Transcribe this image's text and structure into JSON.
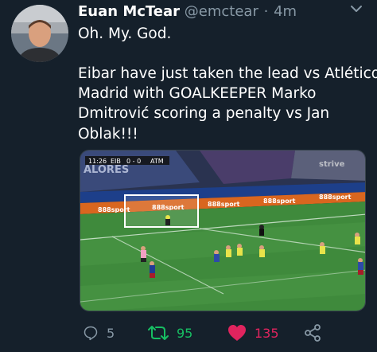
{
  "tweet": {
    "author_name": "Euan McTear",
    "author_handle": "@emctear",
    "separator": "·",
    "time": "4m",
    "text_lines": [
      "Oh. My. God.",
      "Eibar have just taken the lead vs Atlético",
      "Madrid with GOALKEEPER Marko",
      "Dmitrović scoring a penalty vs Jan",
      "Oblak!!!"
    ]
  },
  "media": {
    "scoreboard": {
      "clock": "11:26",
      "home": "EIB",
      "score": "0 - 0",
      "away": "ATM"
    },
    "stand_text": "ALORES",
    "ad_boards": [
      "888sport",
      "888sport",
      "888sport",
      "888sport",
      "888sport"
    ],
    "watermark": "strive"
  },
  "actions": {
    "replies": "5",
    "retweets": "95",
    "likes": "135"
  },
  "colors": {
    "background": "#15202b",
    "secondary_text": "#8899a6",
    "retweet_green": "#17bf63",
    "like_pink": "#e0245e"
  },
  "icons": {
    "menu": "chevron-down-icon",
    "reply": "reply-icon",
    "retweet": "retweet-icon",
    "like": "heart-icon",
    "share": "share-icon"
  }
}
